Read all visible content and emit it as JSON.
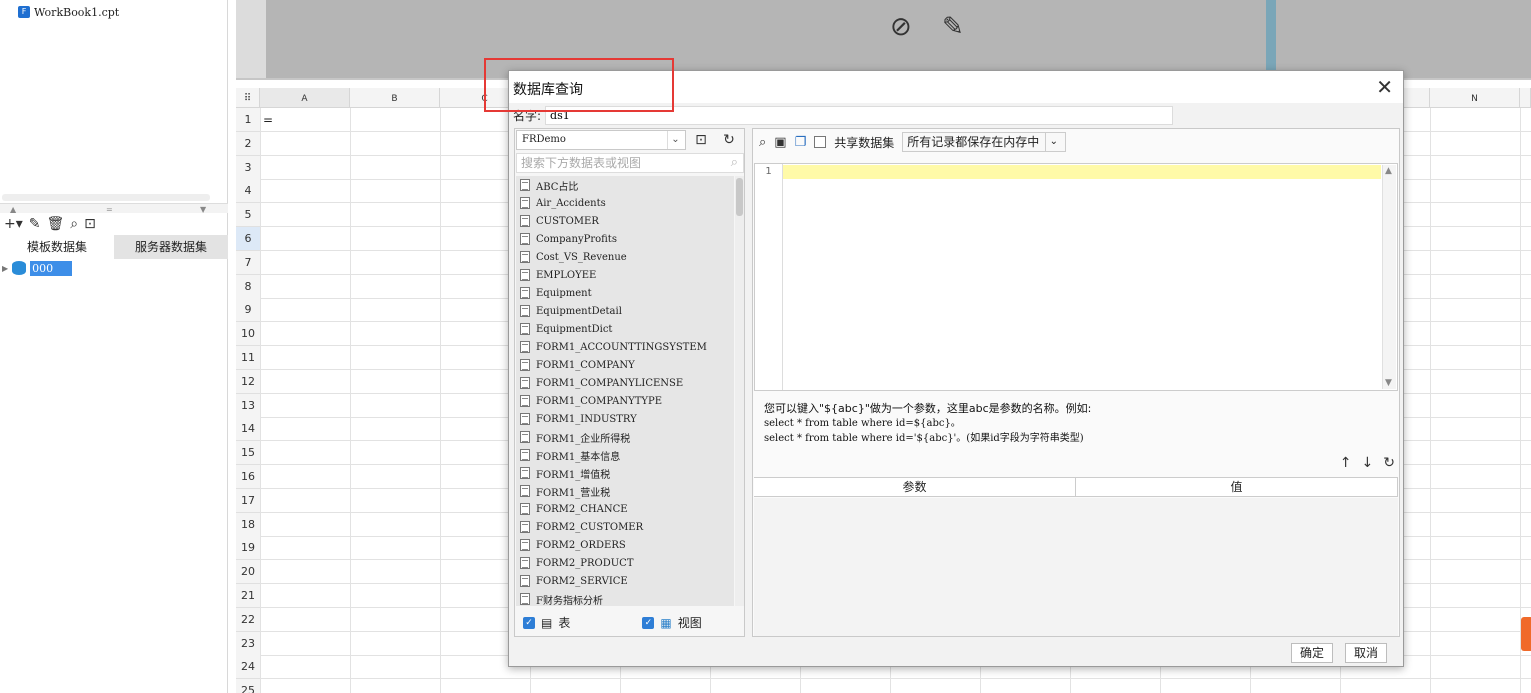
{
  "left_pane": {
    "file_name": "WorkBook1.cpt",
    "tabs": [
      "模板数据集",
      "服务器数据集"
    ],
    "tree_item": "000"
  },
  "sheet": {
    "columns": [
      "A",
      "B",
      "C",
      "N"
    ],
    "rows": [
      "1",
      "2",
      "3",
      "4",
      "5",
      "6",
      "7",
      "8",
      "9",
      "10",
      "11",
      "12",
      "13",
      "14",
      "15",
      "16",
      "17",
      "18",
      "19",
      "20",
      "21",
      "22",
      "23",
      "24",
      "25"
    ],
    "cell_a1": "="
  },
  "dialog": {
    "title": "数据库查询",
    "name_label": "名字:",
    "name_value": "ds1",
    "connection": "FRDemo",
    "search_placeholder": "搜索下方数据表或视图",
    "tables": [
      "ABC占比",
      "Air_Accidents",
      "CUSTOMER",
      "CompanyProfits",
      "Cost_VS_Revenue",
      "EMPLOYEE",
      "Equipment",
      "EquipmentDetail",
      "EquipmentDict",
      "FORM1_ACCOUNTTINGSYSTEM",
      "FORM1_COMPANY",
      "FORM1_COMPANYLICENSE",
      "FORM1_COMPANYTYPE",
      "FORM1_INDUSTRY",
      "FORM1_企业所得税",
      "FORM1_基本信息",
      "FORM1_增值税",
      "FORM1_营业税",
      "FORM2_CHANCE",
      "FORM2_CUSTOMER",
      "FORM2_ORDERS",
      "FORM2_PRODUCT",
      "FORM2_SERVICE",
      "F财务指标分析"
    ],
    "filter_table": "表",
    "filter_view": "视图",
    "share_label": "共享数据集",
    "memory_option": "所有记录都保存在内存中",
    "line_number": "1",
    "hint_line1": "您可以键入\"${abc}\"做为一个参数，这里abc是参数的名称。例如:",
    "hint_line2": "select * from table where id=${abc}。",
    "hint_line3": "select * from table where id='${abc}'。(如果id字段为字符串类型)",
    "param_col": "参数",
    "value_col": "值",
    "ok_button": "确定",
    "cancel_button": "取消"
  }
}
